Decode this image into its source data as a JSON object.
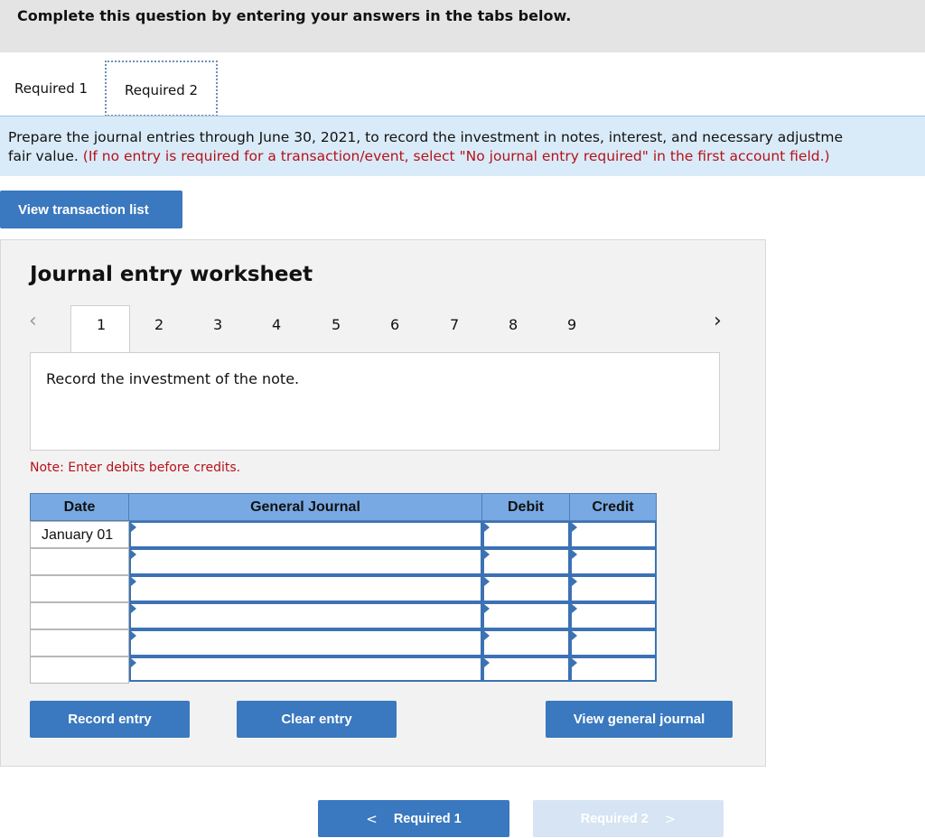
{
  "header": {
    "title": "Complete this question by entering your answers in the tabs below."
  },
  "tabs": [
    {
      "label": "Required 1",
      "active": false
    },
    {
      "label": "Required 2",
      "active": true
    }
  ],
  "instructions": {
    "line1": "Prepare the journal entries through June 30, 2021, to record the investment in notes, interest, and necessary adjustme",
    "line2_plain": "fair value. ",
    "line2_red": "(If no entry is required for a transaction/event, select \"No journal entry required\" in the first account field.)"
  },
  "view_transaction_list_label": "View transaction list",
  "worksheet": {
    "title": "Journal entry worksheet",
    "prev_icon": "chevron-left-icon",
    "next_icon": "chevron-right-icon",
    "steps": [
      "1",
      "2",
      "3",
      "4",
      "5",
      "6",
      "7",
      "8",
      "9"
    ],
    "active_step": "1",
    "description": "Record the investment of the note.",
    "note": "Note: Enter debits before credits."
  },
  "table": {
    "headers": {
      "date": "Date",
      "general_journal": "General Journal",
      "debit": "Debit",
      "credit": "Credit"
    },
    "rows": [
      {
        "date": "January 01",
        "account": "",
        "debit": "",
        "credit": ""
      },
      {
        "date": "",
        "account": "",
        "debit": "",
        "credit": ""
      },
      {
        "date": "",
        "account": "",
        "debit": "",
        "credit": ""
      },
      {
        "date": "",
        "account": "",
        "debit": "",
        "credit": ""
      },
      {
        "date": "",
        "account": "",
        "debit": "",
        "credit": ""
      },
      {
        "date": "",
        "account": "",
        "debit": "",
        "credit": ""
      }
    ]
  },
  "buttons": {
    "record_entry": "Record entry",
    "clear_entry": "Clear entry",
    "view_general_journal": "View general journal"
  },
  "footer_nav": {
    "prev_label": "Required 1",
    "next_label": "Required 2",
    "next_disabled": true
  },
  "colors": {
    "accent": "#3a78bf",
    "header_blue": "#78a9e2",
    "instruction_bg": "#d9ebf8",
    "warning_red": "#b5121b"
  }
}
